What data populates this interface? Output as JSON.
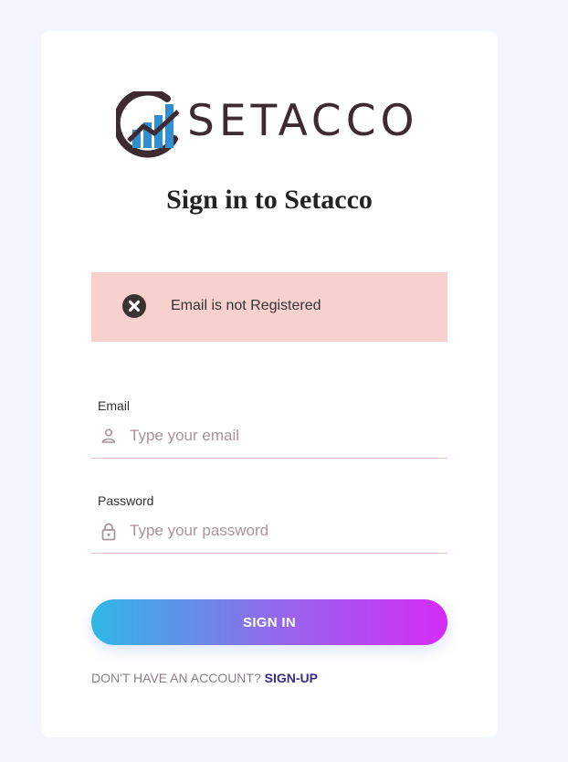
{
  "logo": {
    "text": "SETACCO"
  },
  "title": "Sign in to Setacco",
  "alert": {
    "message": "Email is not Registered",
    "icon": "close-circle-icon"
  },
  "email": {
    "label": "Email",
    "placeholder": "Type your email",
    "value": "",
    "icon": "user-icon"
  },
  "password": {
    "label": "Password",
    "placeholder": "Type your password",
    "value": "",
    "icon": "lock-icon"
  },
  "signin_label": "SIGN IN",
  "footer": {
    "prompt": "DON'T HAVE AN ACCOUNT?",
    "link": "SIGN-UP"
  },
  "colors": {
    "background": "#f3f7fd",
    "alert_bg": "#f8d1cf",
    "gradient_start": "#2fb8e6",
    "gradient_end": "#d52cf8",
    "link": "#3b2a8f"
  }
}
